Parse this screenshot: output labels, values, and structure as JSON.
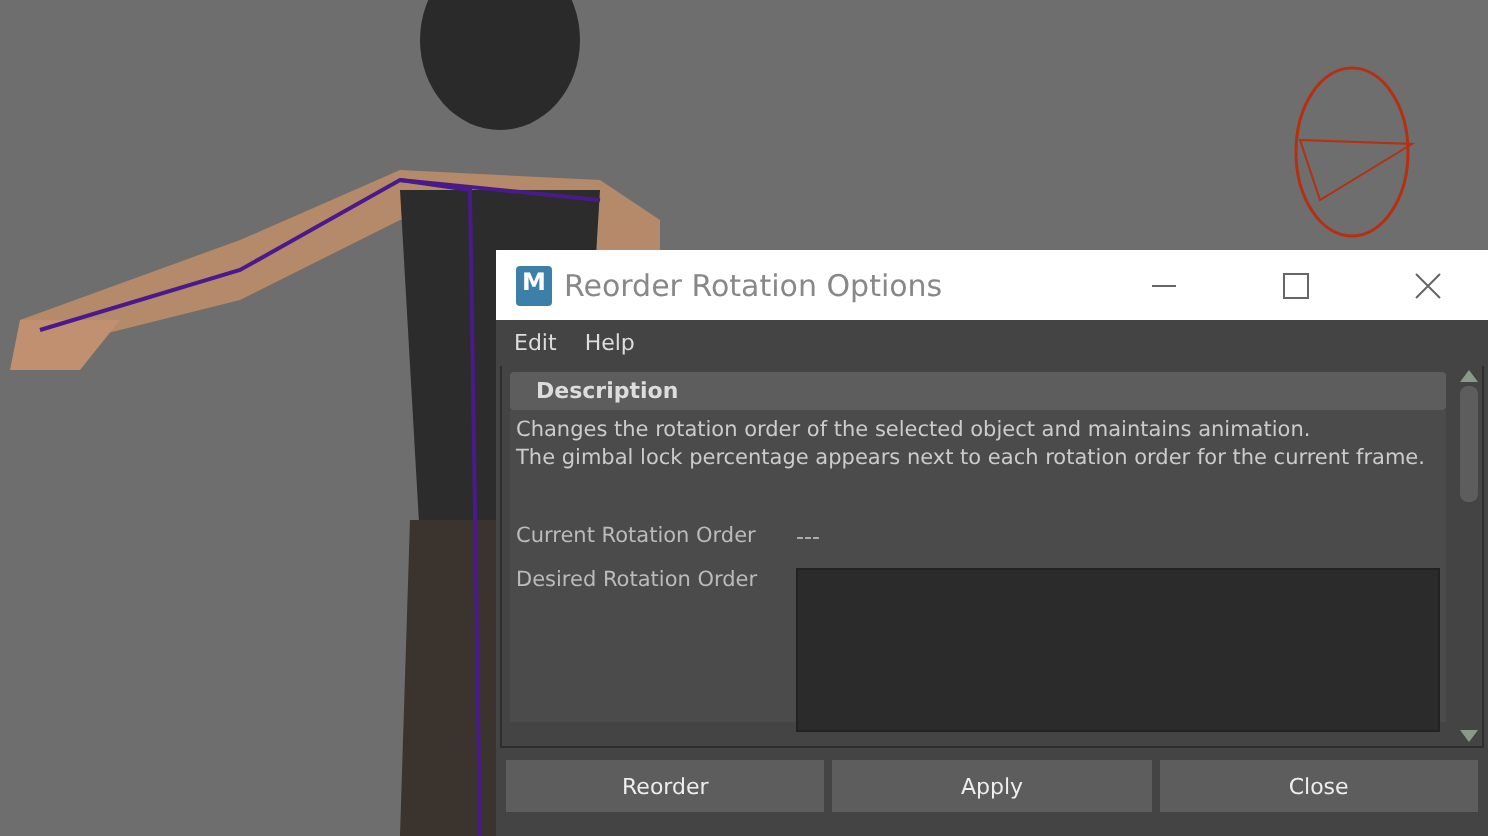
{
  "window": {
    "title": "Reorder Rotation Options",
    "app_icon": "M"
  },
  "menu": [
    "Edit",
    "Help"
  ],
  "section": {
    "title": "Description",
    "lines": [
      "Changes the rotation order of the selected object and maintains animation.",
      "The gimbal lock percentage appears next to each rotation order for the current frame."
    ]
  },
  "current": {
    "label": "Current Rotation Order",
    "value": "---"
  },
  "desired": {
    "label": "Desired Rotation Order"
  },
  "buttons": [
    "Reorder",
    "Apply",
    "Close"
  ]
}
